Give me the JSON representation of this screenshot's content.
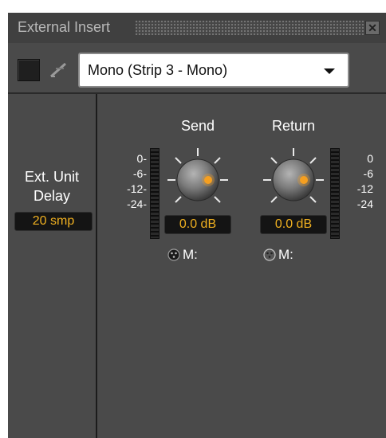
{
  "window": {
    "title": "External Insert"
  },
  "toolbar": {
    "routing_value": "Mono (Strip 3 - Mono)"
  },
  "delay": {
    "label_line1": "Ext. Unit",
    "label_line2": "Delay",
    "value": "20 smp"
  },
  "send": {
    "label": "Send",
    "value": "0.0 dB",
    "scale": [
      "0-",
      "-6-",
      "-12-",
      "-24-"
    ],
    "mic_label": "M:"
  },
  "return": {
    "label": "Return",
    "value": "0.0 dB",
    "scale": [
      "0",
      "-6",
      "-12",
      "-24"
    ],
    "mic_label": "M:"
  },
  "colors": {
    "value_text": "#f0b020",
    "knob_pointer": "#f5a020",
    "panel_bg": "#4a4a4a"
  }
}
